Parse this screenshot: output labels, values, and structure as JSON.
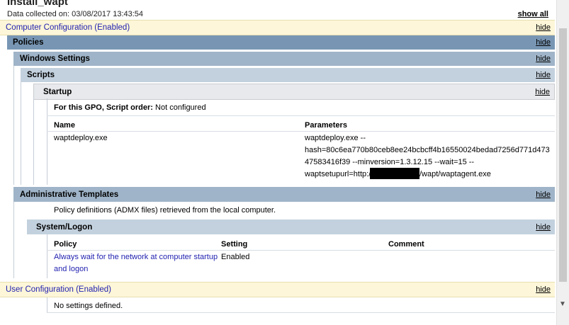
{
  "header": {
    "title": "Install_wapt",
    "collected": "Data collected on: 03/08/2017 13:43:54",
    "show_all": "show all"
  },
  "hide_label": "hide",
  "computer_config": {
    "label": "Computer Configuration (Enabled)"
  },
  "policies": {
    "label": "Policies"
  },
  "windows_settings": {
    "label": "Windows Settings"
  },
  "scripts": {
    "label": "Scripts"
  },
  "startup": {
    "label": "Startup",
    "order_label": "For this GPO, Script order:",
    "order_value": "Not configured",
    "col_name": "Name",
    "col_params": "Parameters",
    "script_name": "waptdeploy.exe",
    "params": [
      "waptdeploy.exe --",
      "hash=80c6ea770b80ceb8ee24bcbcff4b16550024bedad7256d771d473",
      "47583416f39 --minversion=1.3.12.15 --wait=15 --",
      "waptsetupurl=http:/",
      "/wapt/waptagent.exe"
    ]
  },
  "admin_templates": {
    "label": "Administrative Templates",
    "note": "Policy definitions (ADMX files) retrieved from the local computer."
  },
  "system_logon": {
    "label": "System/Logon",
    "col_policy": "Policy",
    "col_setting": "Setting",
    "col_comment": "Comment",
    "policy_line1": "Always wait for the network at computer startup",
    "policy_line2": "and logon",
    "setting": "Enabled"
  },
  "user_config": {
    "label": "User Configuration (Enabled)",
    "note": "No settings defined."
  }
}
